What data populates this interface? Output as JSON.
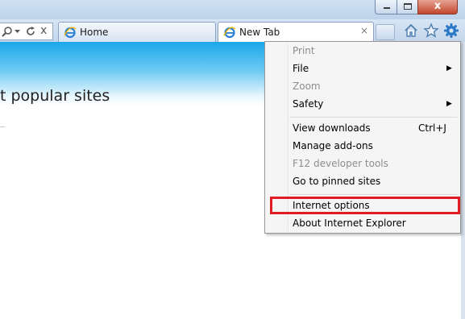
{
  "window": {
    "minimize_glyph": "",
    "maximize_glyph": "",
    "close_glyph": "x"
  },
  "address_bar": {
    "search_icon": "search-icon",
    "dropdown_icon": "chevron-down-icon",
    "refresh_icon": "refresh-icon",
    "stop_icon": "stop-icon",
    "stop_glyph": "x"
  },
  "tabs": [
    {
      "label": "Home",
      "icon": "ie-icon",
      "active": false
    },
    {
      "label": "New Tab",
      "icon": "ie-icon",
      "active": true,
      "close_glyph": "×"
    }
  ],
  "command_icons": [
    "home-icon",
    "star-icon",
    "gear-icon"
  ],
  "page": {
    "heading": "t popular sites",
    "hero_colors": [
      "#1aa7ea",
      "#6fcaf3",
      "#ffffff"
    ]
  },
  "tools_menu": {
    "groups": [
      [
        {
          "label": "Print",
          "enabled": false
        },
        {
          "label": "File",
          "enabled": true,
          "submenu": true
        },
        {
          "label": "Zoom",
          "enabled": false
        },
        {
          "label": "Safety",
          "enabled": true,
          "submenu": true
        }
      ],
      [
        {
          "label": "View downloads",
          "enabled": true,
          "shortcut": "Ctrl+J"
        },
        {
          "label": "Manage add-ons",
          "enabled": true
        },
        {
          "label": "F12 developer tools",
          "enabled": false
        },
        {
          "label": "Go to pinned sites",
          "enabled": true
        }
      ],
      [
        {
          "label": "Internet options",
          "enabled": true,
          "highlighted": true
        },
        {
          "label": "About Internet Explorer",
          "enabled": true
        }
      ]
    ],
    "submenu_arrow": "▶",
    "highlight_color": "#e01b24"
  }
}
